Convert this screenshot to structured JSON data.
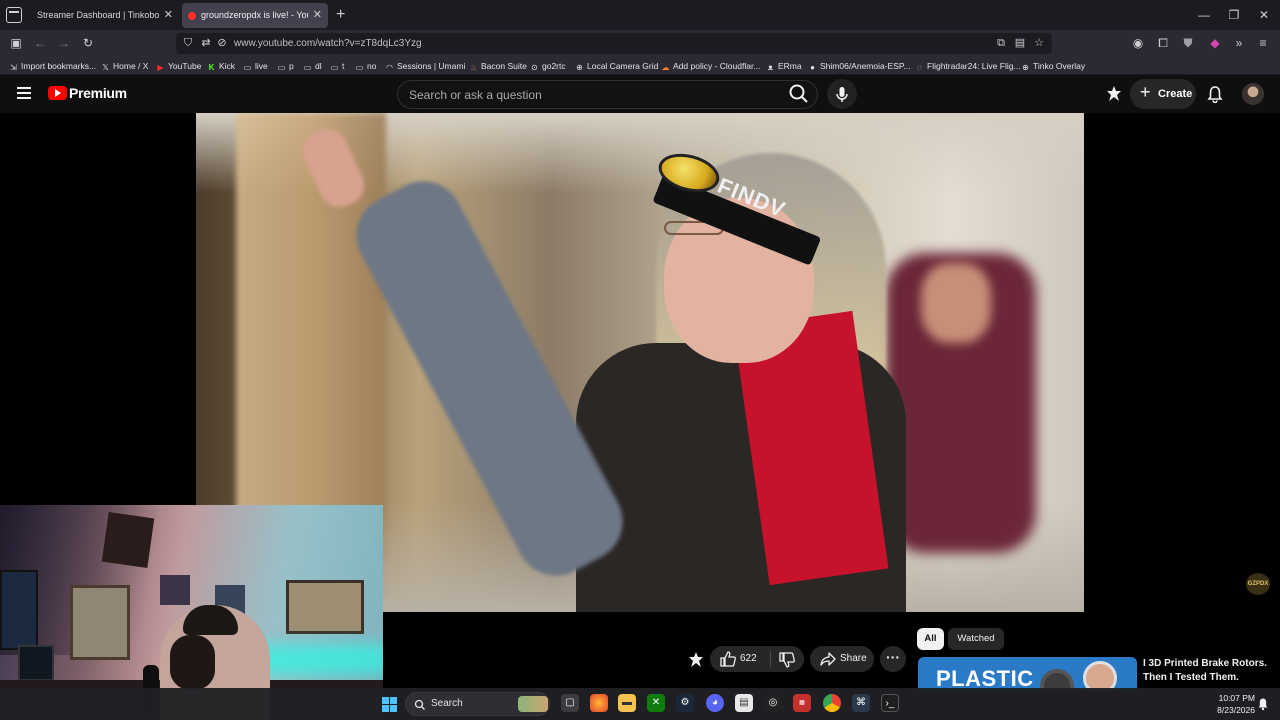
{
  "browser": {
    "tabs": [
      {
        "title": "Streamer Dashboard | Tinkobot",
        "active": false
      },
      {
        "title": "groundzeropdx is live! - YouTube",
        "active": true
      }
    ],
    "url": "www.youtube.com/watch?v=zT8dqLc3Yzg",
    "bookmarks": [
      {
        "label": "Import bookmarks...",
        "icon": "import-icon"
      },
      {
        "label": "Home / X",
        "icon": "x-logo-icon"
      },
      {
        "label": "YouTube",
        "icon": "youtube-icon"
      },
      {
        "label": "Kick",
        "icon": "kick-icon"
      },
      {
        "label": "live",
        "icon": "folder-icon"
      },
      {
        "label": "p",
        "icon": "folder-icon"
      },
      {
        "label": "dl",
        "icon": "folder-icon"
      },
      {
        "label": "t",
        "icon": "folder-icon"
      },
      {
        "label": "no",
        "icon": "folder-icon"
      },
      {
        "label": "Sessions | Umami",
        "icon": "umami-icon"
      },
      {
        "label": "Bacon Suite",
        "icon": "bacon-icon"
      },
      {
        "label": "go2rtc",
        "icon": "go2rtc-icon"
      },
      {
        "label": "Local Camera Grid",
        "icon": "globe-icon"
      },
      {
        "label": "Add policy - Cloudflar...",
        "icon": "cloudflare-icon"
      },
      {
        "label": "ERma",
        "icon": "erma-icon"
      },
      {
        "label": "Shim06/Anemoia-ESP...",
        "icon": "github-icon"
      },
      {
        "label": "Flightradar24: Live Flig...",
        "icon": "flightradar-icon"
      },
      {
        "label": "Tinko Overlay",
        "icon": "globe-icon"
      }
    ]
  },
  "youtube": {
    "logo_text": "Premium",
    "search_placeholder": "Search or ask a question",
    "create_label": "Create",
    "headband_text": "FINDV",
    "watermark_text": "GZPDX",
    "like_count": "622",
    "share_label": "Share",
    "chips": [
      "All",
      "Watched"
    ],
    "recommendation": {
      "thumb_text": "PLASTIC",
      "title": "I 3D Printed Brake Rotors. Then I Tested Them."
    }
  },
  "taskbar": {
    "search_label": "Search",
    "time": "10:07 PM",
    "date": "8/23/2026",
    "apps": [
      "file-explorer-icon",
      "firefox-icon",
      "folder-icon",
      "xbox-icon",
      "steam-icon",
      "discord-icon",
      "notepad-icon",
      "obs-icon",
      "mixer-icon",
      "chrome-icon",
      "network-tool-icon",
      "terminal-icon"
    ]
  },
  "colors": {
    "youtube_red": "#ff0000",
    "page_bg": "#0f0f0f",
    "chrome_tabbar": "#1c1b22",
    "chrome_toolbar": "#2b2a33"
  }
}
